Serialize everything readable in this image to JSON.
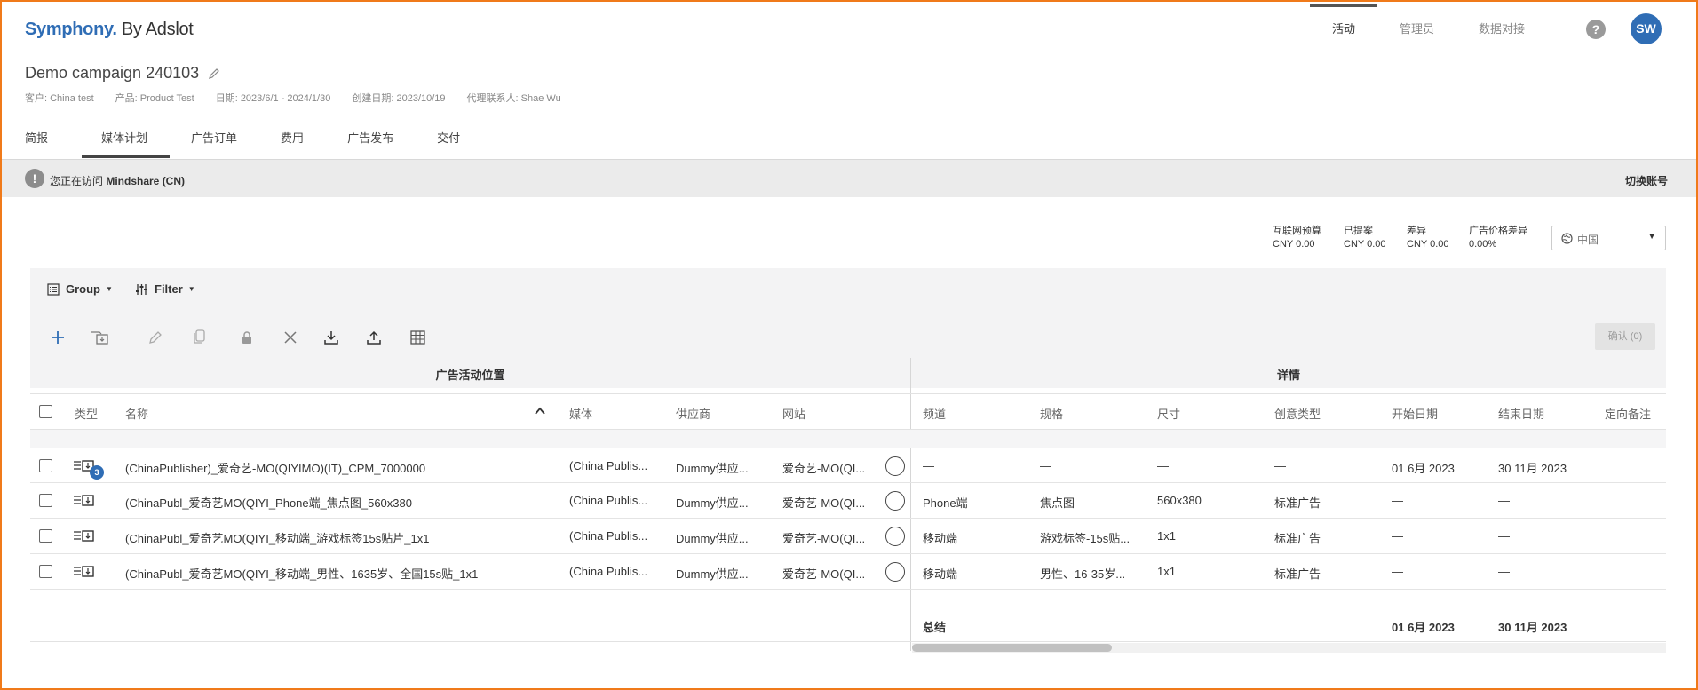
{
  "brand": {
    "name": "Symphony.",
    "suffix": " By Adslot"
  },
  "topnav": [
    {
      "label": "活动",
      "active": true
    },
    {
      "label": "管理员",
      "active": false
    },
    {
      "label": "数据对接",
      "active": false
    }
  ],
  "help_label": "?",
  "user_initials": "SW",
  "campaign": {
    "title": "Demo campaign 240103",
    "meta": {
      "client": "客户: China test",
      "product": "产品: Product Test",
      "dates": "日期: 2023/6/1 - 2024/1/30",
      "created": "创建日期: 2023/10/19",
      "agency_contact": "代理联系人: Shae Wu"
    }
  },
  "tabs": [
    "简报",
    "媒体计划",
    "广告订单",
    "费用",
    "广告发布",
    "交付"
  ],
  "active_tab": "媒体计划",
  "notice": {
    "prefix": "您正在访问 ",
    "account": "Mindshare (CN)",
    "switch_label": "切换账号"
  },
  "budget": [
    {
      "label": "互联网预算",
      "value": "CNY 0.00"
    },
    {
      "label": "已提案",
      "value": "CNY 0.00"
    },
    {
      "label": "差异",
      "value": "CNY 0.00"
    },
    {
      "label": "广告价格差异",
      "value": "0.00%"
    }
  ],
  "region": {
    "selected": "中国"
  },
  "toolbar": {
    "group_label": "Group",
    "filter_label": "Filter",
    "confirm_label": "确认 (0)"
  },
  "sections": {
    "left": "广告活动位置",
    "right": "详情"
  },
  "columns": [
    "类型",
    "名称",
    "媒体",
    "供应商",
    "网站",
    "频道",
    "规格",
    "尺寸",
    "创意类型",
    "开始日期",
    "结束日期",
    "定向备注"
  ],
  "rows": [
    {
      "badge": "3",
      "name": "(ChinaPublisher)_爱奇艺-MO(QIYIMO)(IT)_CPM_7000000",
      "media": "(China Publis...",
      "supplier": "Dummy供应...",
      "site": "爱奇艺-MO(QI...",
      "channel": "—",
      "spec": "—",
      "size": "—",
      "creative": "—",
      "start": "01 6月 2023",
      "end": "30 11月 2023"
    },
    {
      "badge": "",
      "name": "(ChinaPubl_爱奇艺MO(QIYI_Phone端_焦点图_560x380",
      "media": "(China Publis...",
      "supplier": "Dummy供应...",
      "site": "爱奇艺-MO(QI...",
      "channel": "Phone端",
      "spec": "焦点图",
      "size": "560x380",
      "creative": "标准广告",
      "start": "—",
      "end": "—"
    },
    {
      "badge": "",
      "name": "(ChinaPubl_爱奇艺MO(QIYI_移动端_游戏标签15s贴片_1x1",
      "media": "(China Publis...",
      "supplier": "Dummy供应...",
      "site": "爱奇艺-MO(QI...",
      "channel": "移动端",
      "spec": "游戏标签-15s贴...",
      "size": "1x1",
      "creative": "标准广告",
      "start": "—",
      "end": "—"
    },
    {
      "badge": "",
      "name": "(ChinaPubl_爱奇艺MO(QIYI_移动端_男性、1635岁、全国15s贴_1x1",
      "media": "(China Publis...",
      "supplier": "Dummy供应...",
      "site": "爱奇艺-MO(QI...",
      "channel": "移动端",
      "spec": "男性、16-35岁...",
      "size": "1x1",
      "creative": "标准广告",
      "start": "—",
      "end": "—"
    }
  ],
  "summary": {
    "label": "总结",
    "start": "01 6月 2023",
    "end": "30 11月 2023"
  }
}
